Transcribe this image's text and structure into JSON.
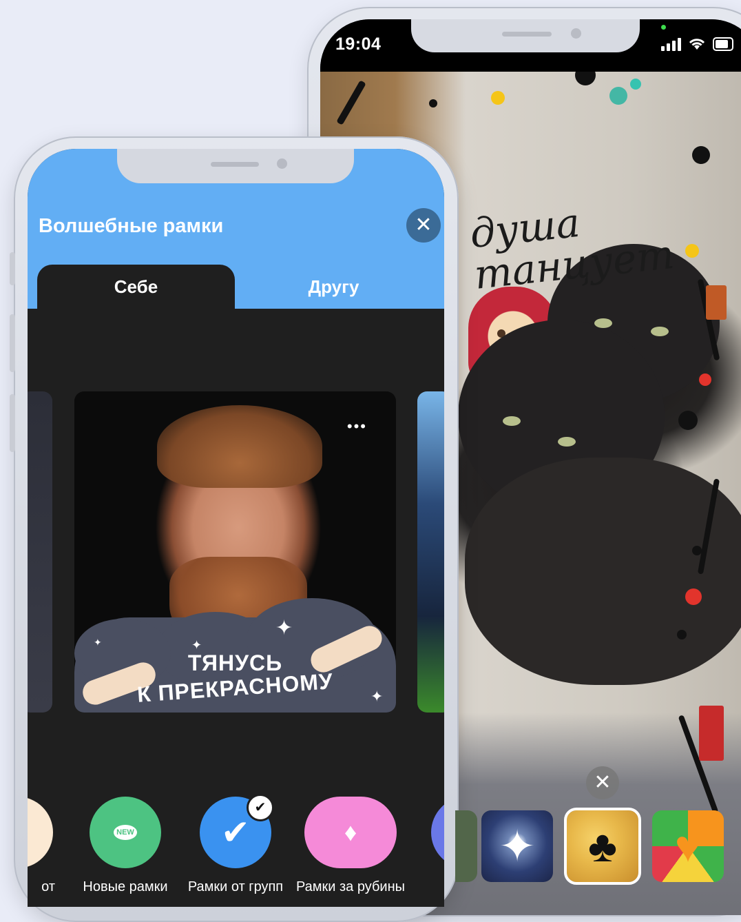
{
  "back_phone": {
    "status_time": "19:04",
    "frame_text": "душа\nтанцует",
    "close_label": "✕",
    "thumbnails": [
      {
        "name": "frame-thumb-sparkle",
        "glyph": "✦"
      },
      {
        "name": "frame-thumb-dancer",
        "glyph": "♣"
      },
      {
        "name": "frame-thumb-hearts",
        "glyph": "♥"
      }
    ]
  },
  "front_phone": {
    "title": "Волшебные рамки",
    "close_label": "✕",
    "tabs": [
      {
        "label": "Себе",
        "active": true
      },
      {
        "label": "Другу",
        "active": false
      }
    ],
    "card": {
      "more_label": "•••",
      "caption_line1": "ТЯНУСЬ",
      "caption_line2": "К ПРЕКРАСНОМУ"
    },
    "categories": [
      {
        "label": "от",
        "icon": "partial-icon",
        "color": "#fbe9d3"
      },
      {
        "label": "Новые рамки",
        "icon": "new-badge-icon",
        "badge_text": "NEW",
        "color": "#4dc382"
      },
      {
        "label": "Рамки от групп",
        "icon": "check-icon",
        "color": "#3a92f0",
        "checked": true
      },
      {
        "label": "Рамки за рубины",
        "icon": "diamond-icon",
        "color": "#f58ad8"
      }
    ]
  },
  "colors": {
    "background": "#e9ecf7",
    "header_blue": "#62aef4",
    "dark_bg": "#1f1f1f"
  }
}
